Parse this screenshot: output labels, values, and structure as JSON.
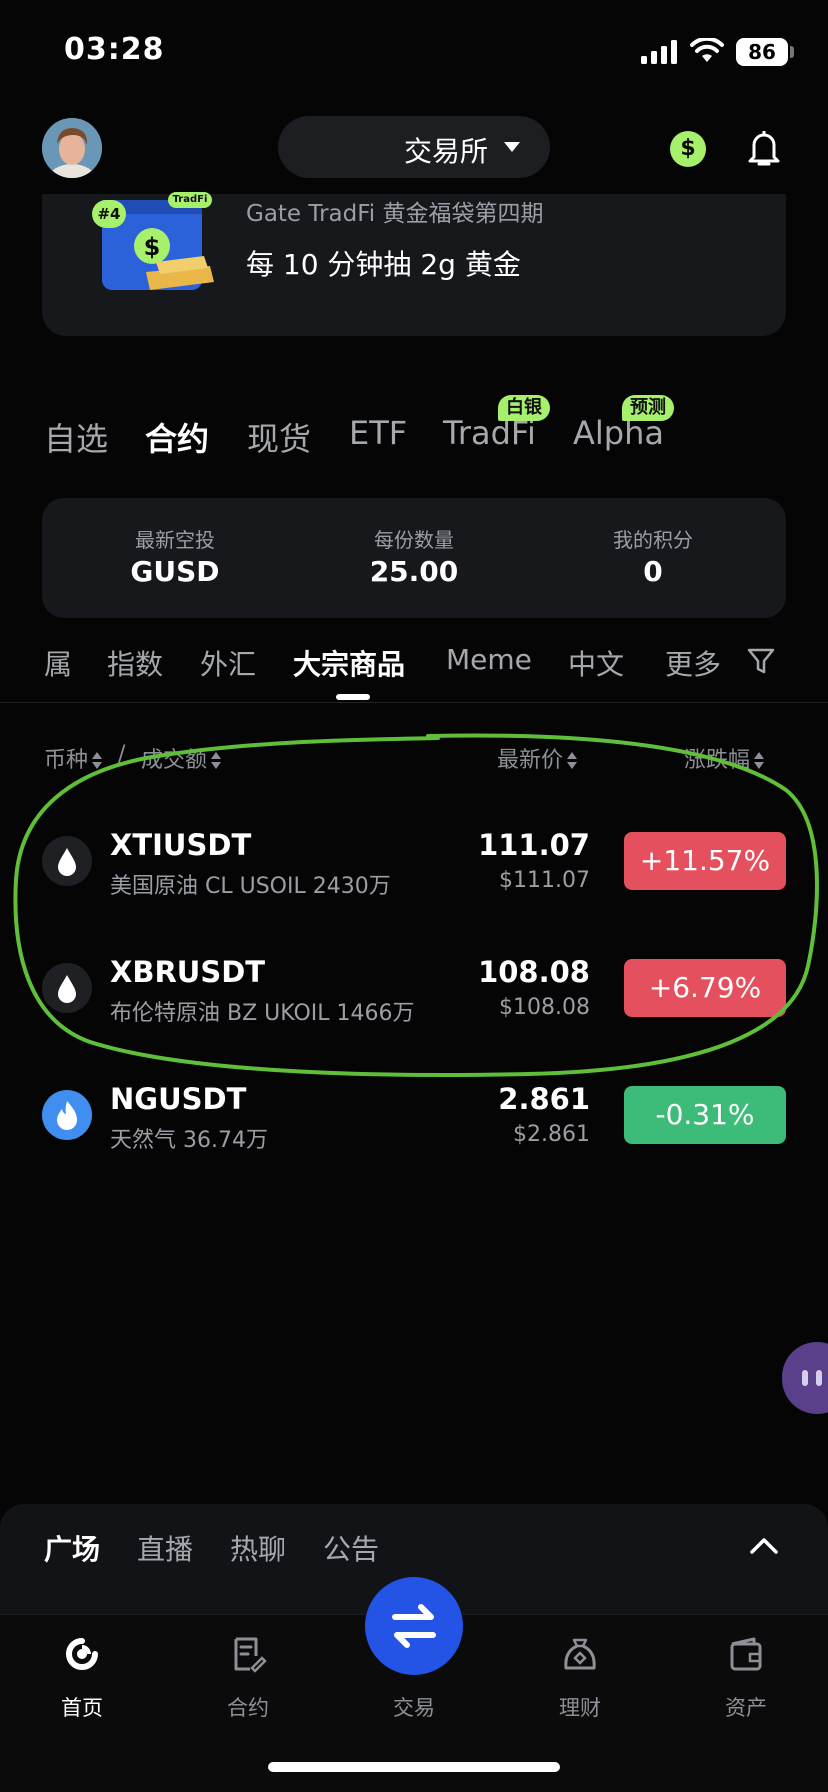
{
  "status_bar": {
    "time": "03:28",
    "battery": "86"
  },
  "header": {
    "exchange_label": "交易所",
    "currency_symbol": "$"
  },
  "banner": {
    "edition_badge": "#4",
    "brand_tag": "TradFi",
    "subtitle": "Gate TradFi 黄金福袋第四期",
    "title": "每 10 分钟抽 2g 黄金"
  },
  "main_tabs": [
    {
      "label": "自选"
    },
    {
      "label": "合约",
      "active": true
    },
    {
      "label": "现货"
    },
    {
      "label": "ETF"
    },
    {
      "label": "TradFi",
      "badge": "白银"
    },
    {
      "label": "Alpha",
      "badge": "预测"
    }
  ],
  "points_card": [
    {
      "label": "最新空投",
      "value": "GUSD"
    },
    {
      "label": "每份数量",
      "value": "25.00"
    },
    {
      "label": "我的积分",
      "value": "0"
    }
  ],
  "sub_tabs": [
    {
      "label": "属"
    },
    {
      "label": "指数"
    },
    {
      "label": "外汇"
    },
    {
      "label": "大宗商品",
      "active": true
    },
    {
      "label": "Meme"
    },
    {
      "label": "中文"
    },
    {
      "label": "更多"
    }
  ],
  "columns": {
    "coin": "币种",
    "sep": "/",
    "volume": "成交额",
    "price": "最新价",
    "change": "涨跌幅"
  },
  "rows": [
    {
      "symbol": "XTIUSDT",
      "desc": "美国原油 CL USOIL 2430万",
      "price": "111.07",
      "usd": "$111.07",
      "change": "+11.57%",
      "color": "#e5505e",
      "icon": "oil-drop-icon"
    },
    {
      "symbol": "XBRUSDT",
      "desc": "布伦特原油 BZ UKOIL 1466万",
      "price": "108.08",
      "usd": "$108.08",
      "change": "+6.79%",
      "color": "#e5505e",
      "icon": "oil-drop-icon"
    },
    {
      "symbol": "NGUSDT",
      "desc": "天然气 36.74万",
      "price": "2.861",
      "usd": "$2.861",
      "change": "-0.31%",
      "color": "#3dbb79",
      "icon": "gas-flame-icon"
    }
  ],
  "social_tabs": [
    {
      "label": "广场",
      "active": true
    },
    {
      "label": "直播"
    },
    {
      "label": "热聊"
    },
    {
      "label": "公告"
    }
  ],
  "bottom_nav": [
    {
      "label": "首页",
      "active": true,
      "icon": "home-icon"
    },
    {
      "label": "合约",
      "icon": "contract-icon"
    },
    {
      "label": "交易",
      "icon": "swap-icon"
    },
    {
      "label": "理财",
      "icon": "earn-icon"
    },
    {
      "label": "资产",
      "icon": "wallet-icon"
    }
  ],
  "colors": {
    "accent_green": "#a7f06c",
    "up_red": "#e5505e",
    "down_green": "#3dbb79",
    "trade_blue": "#2354e6",
    "highlight_stroke": "#5fbf3a"
  }
}
